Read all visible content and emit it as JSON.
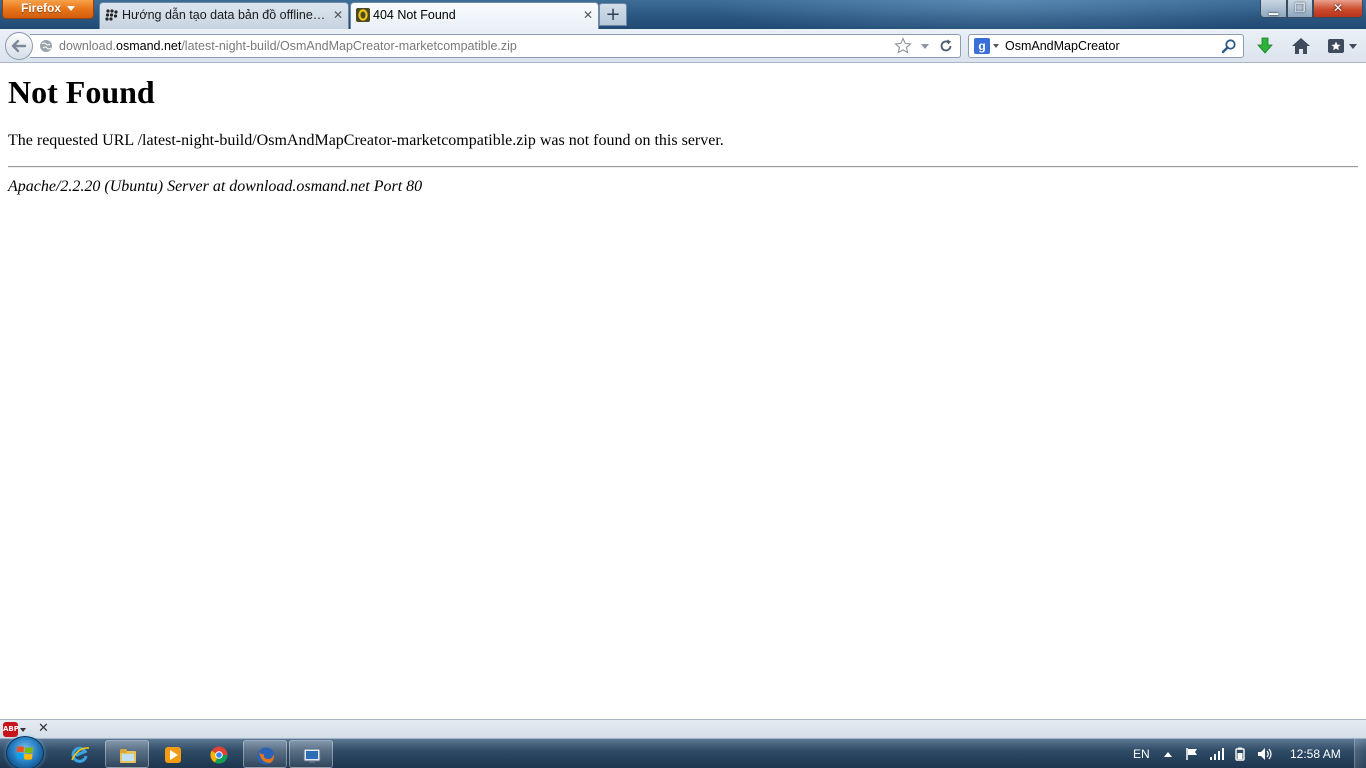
{
  "window": {
    "app_menu_label": "Firefox",
    "tabs": [
      {
        "label": "Hướng dẫn tạo data bản đồ offline c...",
        "active": false,
        "favicon": "blackberry-icon"
      },
      {
        "label": "404 Not Found",
        "active": true,
        "favicon": "osmand-icon"
      }
    ],
    "controls": [
      "minimize-icon",
      "maximize-icon",
      "close-icon"
    ]
  },
  "toolbar": {
    "url_host_prefix": "download.",
    "url_host": "osmand.net",
    "url_path": "/latest-night-build/OsmAndMapCreator-marketcompatible.zip",
    "search_engine": "g",
    "search_value": "OsmAndMapCreator",
    "icons": [
      "back-arrow-icon",
      "globe-icon",
      "star-icon",
      "history-dropdown-icon",
      "reload-icon",
      "search-icon",
      "download-icon",
      "home-icon",
      "bookmarks-icon"
    ]
  },
  "page": {
    "heading": "Not Found",
    "message": "The requested URL /latest-night-build/OsmAndMapCreator-marketcompatible.zip was not found on this server.",
    "server_signature": "Apache/2.2.20 (Ubuntu) Server at download.osmand.net Port 80"
  },
  "addon_bar": {
    "abp_label": "ABP"
  },
  "taskbar": {
    "apps": [
      "internet-explorer-icon",
      "windows-explorer-icon",
      "media-player-icon",
      "chrome-icon",
      "firefox-icon",
      "remote-desktop-icon"
    ],
    "language": "EN",
    "clock": "12:58 AM"
  },
  "colors": {
    "firefox_button": "#e7751a",
    "titlebar": "#2a5680",
    "taskbar": "#1e364f"
  }
}
